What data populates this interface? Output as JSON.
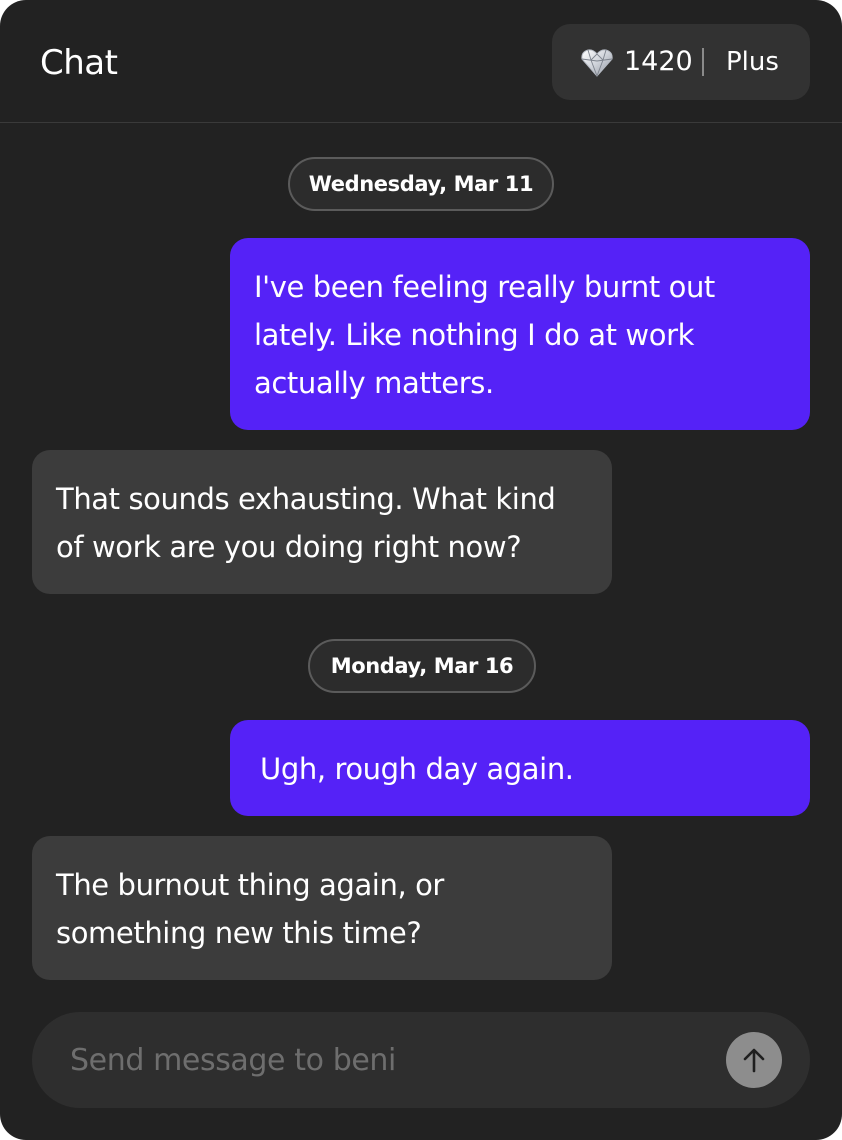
{
  "header": {
    "title": "Chat",
    "balance": "1420",
    "plan": "Plus",
    "balance_icon": "gem-icon"
  },
  "messages": [
    {
      "type": "date",
      "text": "Wednesday, Mar 11"
    },
    {
      "type": "user",
      "text": "I've been feeling really burnt out lately. Like nothing I do at work actually matters."
    },
    {
      "type": "bot",
      "text": "That sounds exhausting. What kind of work are you doing right now?"
    },
    {
      "type": "date",
      "text": "Monday, Mar 16"
    },
    {
      "type": "user",
      "text": "Ugh, rough day again."
    },
    {
      "type": "bot",
      "text": "The burnout thing again, or something new this time?"
    }
  ],
  "composer": {
    "placeholder": "Send message to beni",
    "value": "",
    "send_icon": "arrow-up-icon"
  },
  "colors": {
    "background": "#222222",
    "user_bubble": "#5522f7",
    "bot_bubble": "#3c3c3c",
    "send_button": "#8d8d8d"
  }
}
